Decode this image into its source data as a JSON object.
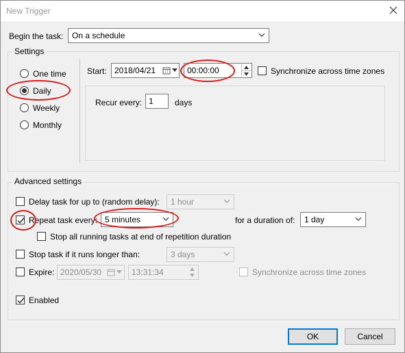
{
  "window": {
    "title": "New Trigger"
  },
  "begin_task": {
    "label": "Begin the task:",
    "value": "On a schedule"
  },
  "settings": {
    "group_title": "Settings",
    "schedule_options": [
      "One time",
      "Daily",
      "Weekly",
      "Monthly"
    ],
    "selected": "Daily",
    "start_label": "Start:",
    "start_date": "2018/04/21",
    "start_time": "00:00:00",
    "sync_label": "Synchronize across time zones",
    "recur_label": "Recur every:",
    "recur_value": "1",
    "recur_unit": "days"
  },
  "advanced": {
    "group_title": "Advanced settings",
    "delay_label": "Delay task for up to (random delay):",
    "delay_value": "1 hour",
    "repeat_label": "Repeat task every:",
    "repeat_value": "5 minutes",
    "duration_label": "for a duration of:",
    "duration_value": "1 day",
    "stop_all_label": "Stop all running tasks at end of repetition duration",
    "stop_longer_label": "Stop task if it runs longer than:",
    "stop_longer_value": "3 days",
    "expire_label": "Expire:",
    "expire_date": "2020/05/30",
    "expire_time": "13:31:34",
    "expire_sync_label": "Synchronize across time zones",
    "enabled_label": "Enabled"
  },
  "buttons": {
    "ok": "OK",
    "cancel": "Cancel"
  },
  "colors": {
    "accent": "#0078d7",
    "annotation": "#d81b1b"
  },
  "icons": [
    "close-icon",
    "calendar-icon",
    "chevron-down-icon",
    "spin-up-icon",
    "spin-down-icon",
    "check-icon"
  ]
}
